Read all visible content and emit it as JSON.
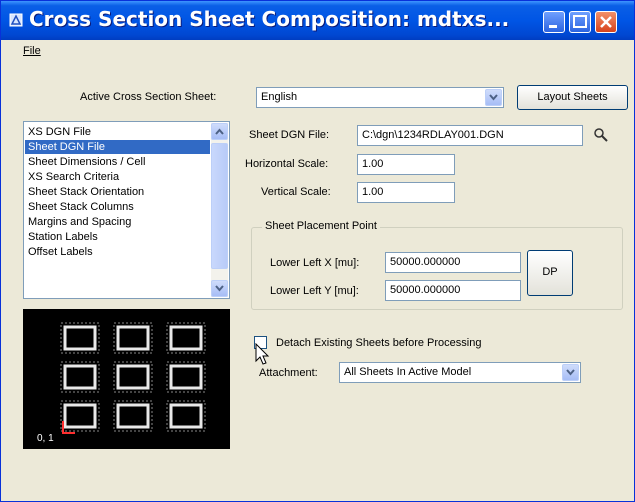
{
  "window": {
    "title": "Cross Section Sheet Composition: mdtxs...",
    "controls": {
      "minimize": "minimize-icon",
      "maximize": "maximize-icon",
      "close": "close-icon"
    }
  },
  "menu": {
    "file": "File"
  },
  "active_sheet": {
    "label": "Active Cross Section Sheet:",
    "value": "English",
    "layout_button": "Layout Sheets"
  },
  "categories": {
    "items": [
      "XS DGN File",
      "Sheet DGN File",
      "Sheet Dimensions / Cell",
      "XS Search Criteria",
      "Sheet Stack Orientation",
      "Sheet Stack Columns",
      "Margins and Spacing",
      "Station Labels",
      "Offset Labels"
    ],
    "selected_index": 1
  },
  "preview": {
    "origin_label": "0, 1"
  },
  "sheet_dgn": {
    "file_label": "Sheet DGN File:",
    "file_value": "C:\\dgn\\1234RDLAY001.DGN",
    "horizontal_scale_label": "Horizontal Scale:",
    "horizontal_scale_value": "1.00",
    "vertical_scale_label": "Vertical Scale:",
    "vertical_scale_value": "1.00"
  },
  "placement": {
    "group_title": "Sheet Placement Point",
    "lower_left_x_label": "Lower Left X [mu]:",
    "lower_left_x_value": "50000.000000",
    "lower_left_y_label": "Lower Left Y [mu]:",
    "lower_left_y_value": "50000.000000",
    "dp_button": "DP"
  },
  "detach": {
    "label": "Detach Existing Sheets before Processing",
    "checked": false
  },
  "attachment": {
    "label": "Attachment:",
    "value": "All Sheets In Active Model"
  },
  "colors": {
    "title_bar": "#0055e5",
    "selection": "#316ac5",
    "dialog_bg": "#ece9d8"
  }
}
